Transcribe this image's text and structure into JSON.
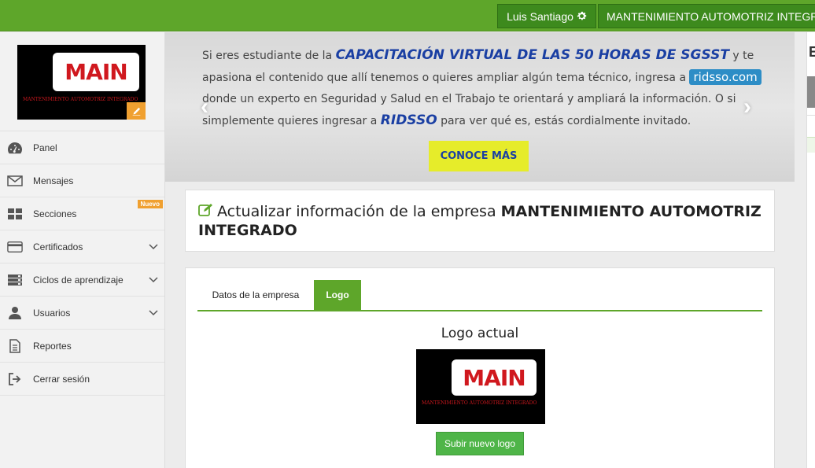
{
  "header": {
    "user_name": "Luis Santiago",
    "company_name": "MANTENIMIENTO AUTOMOTRIZ INTEGRADO",
    "colors": {
      "brand_green": "#5ea62a",
      "dark_green": "#3d8a1d"
    }
  },
  "logo": {
    "brand": "MAIN",
    "tagline": "MANTENIMIENTO AUTOMOTRIZ INTEGRADO"
  },
  "sidebar": {
    "items": [
      {
        "label": "Panel",
        "icon": "dashboard-icon"
      },
      {
        "label": "Mensajes",
        "icon": "envelope-icon"
      },
      {
        "label": "Secciones",
        "icon": "grid-icon",
        "badge": "Nuevo"
      },
      {
        "label": "Certificados",
        "icon": "credit-card-icon",
        "expandable": true
      },
      {
        "label": "Ciclos de aprendizaje",
        "icon": "server-icon",
        "expandable": true
      },
      {
        "label": "Usuarios",
        "icon": "user-icon",
        "expandable": true
      },
      {
        "label": "Reportes",
        "icon": "file-text-icon"
      },
      {
        "label": "Cerrar sesión",
        "icon": "sign-out-icon"
      }
    ]
  },
  "banner": {
    "t1": "Si eres estudiante de la ",
    "hl1": "CAPACITACIÓN VIRTUAL DE LAS 50 HORAS DE SGSST",
    "t2": " y te apasiona el contenido que allí tenemos o quieres ampliar algún tema técnico, ingresa a ",
    "hl2": "ridsso.com",
    "t3": " donde un experto en Seguridad y Salud en el Trabajo te orientará y ampliará la información. O si simplemente quieres ingresar a ",
    "hl3": "RIDSSO",
    "t4": " para ver qué es, estás cordialmente invitado.",
    "cta": "CONOCE MÁS"
  },
  "right_panel": {
    "title_initial": "E"
  },
  "page": {
    "title_prefix": "Actualizar información de la empresa ",
    "title_company": "MANTENIMIENTO AUTOMOTRIZ INTEGRADO"
  },
  "tabs": [
    {
      "label": "Datos de la empresa",
      "active": false
    },
    {
      "label": "Logo",
      "active": true
    }
  ],
  "logo_section": {
    "heading": "Logo actual",
    "upload_label": "Subir nuevo logo"
  }
}
